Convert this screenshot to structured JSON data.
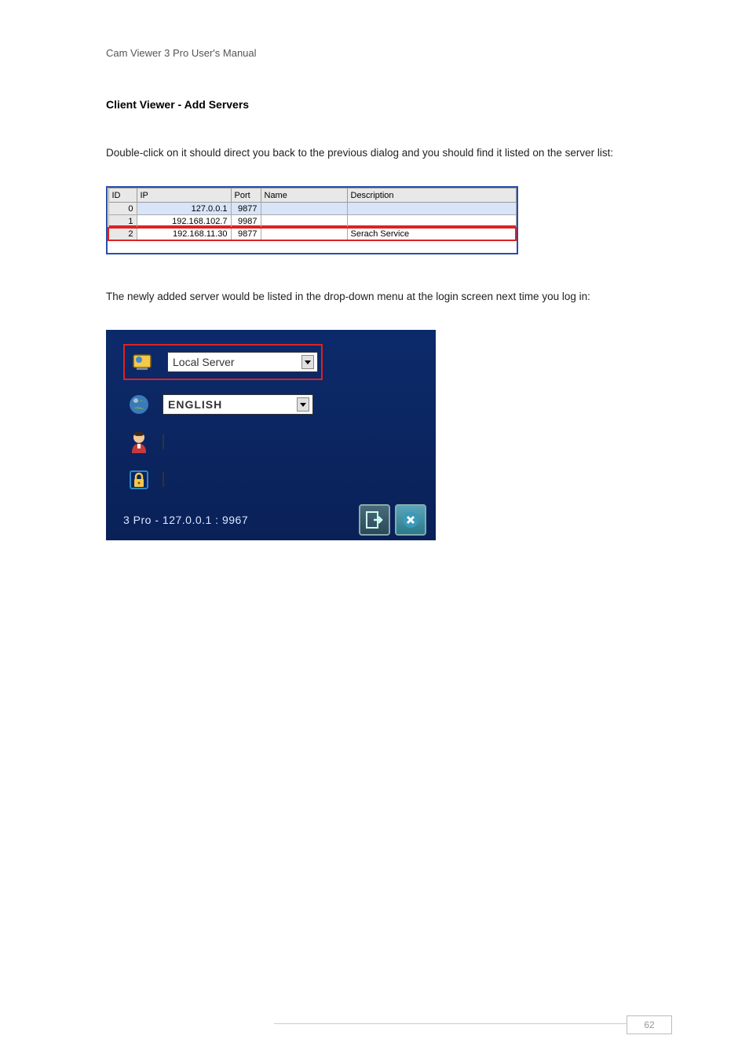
{
  "doc_header": "Cam Viewer 3 Pro User's Manual",
  "section_title": "Client Viewer - Add Servers",
  "para1": "Double-click on it should direct you back to the previous dialog and you should find it listed on the server list:",
  "para2": "The newly added server would be listed in the drop-down menu at the login screen next time you log in:",
  "server_table": {
    "headers": {
      "id": "ID",
      "ip": "IP",
      "port": "Port",
      "name": "Name",
      "desc": "Description"
    },
    "rows": [
      {
        "id": "0",
        "ip": "127.0.0.1",
        "port": "9877",
        "name": "",
        "desc": ""
      },
      {
        "id": "1",
        "ip": "192.168.102.7",
        "port": "9987",
        "name": "",
        "desc": ""
      },
      {
        "id": "2",
        "ip": "192.168.11.30",
        "port": "9877",
        "name": "",
        "desc": "Serach Service"
      }
    ]
  },
  "login": {
    "server_dropdown": "Local Server",
    "language_dropdown": "ENGLISH",
    "username": "",
    "password": "",
    "status": "3 Pro - 127.0.0.1 : 9967"
  },
  "icons": {
    "server": "server-icon",
    "globe": "globe-icon",
    "user": "user-icon",
    "lock": "lock-icon",
    "login": "login-icon",
    "close": "close-icon"
  },
  "page_number": "62"
}
